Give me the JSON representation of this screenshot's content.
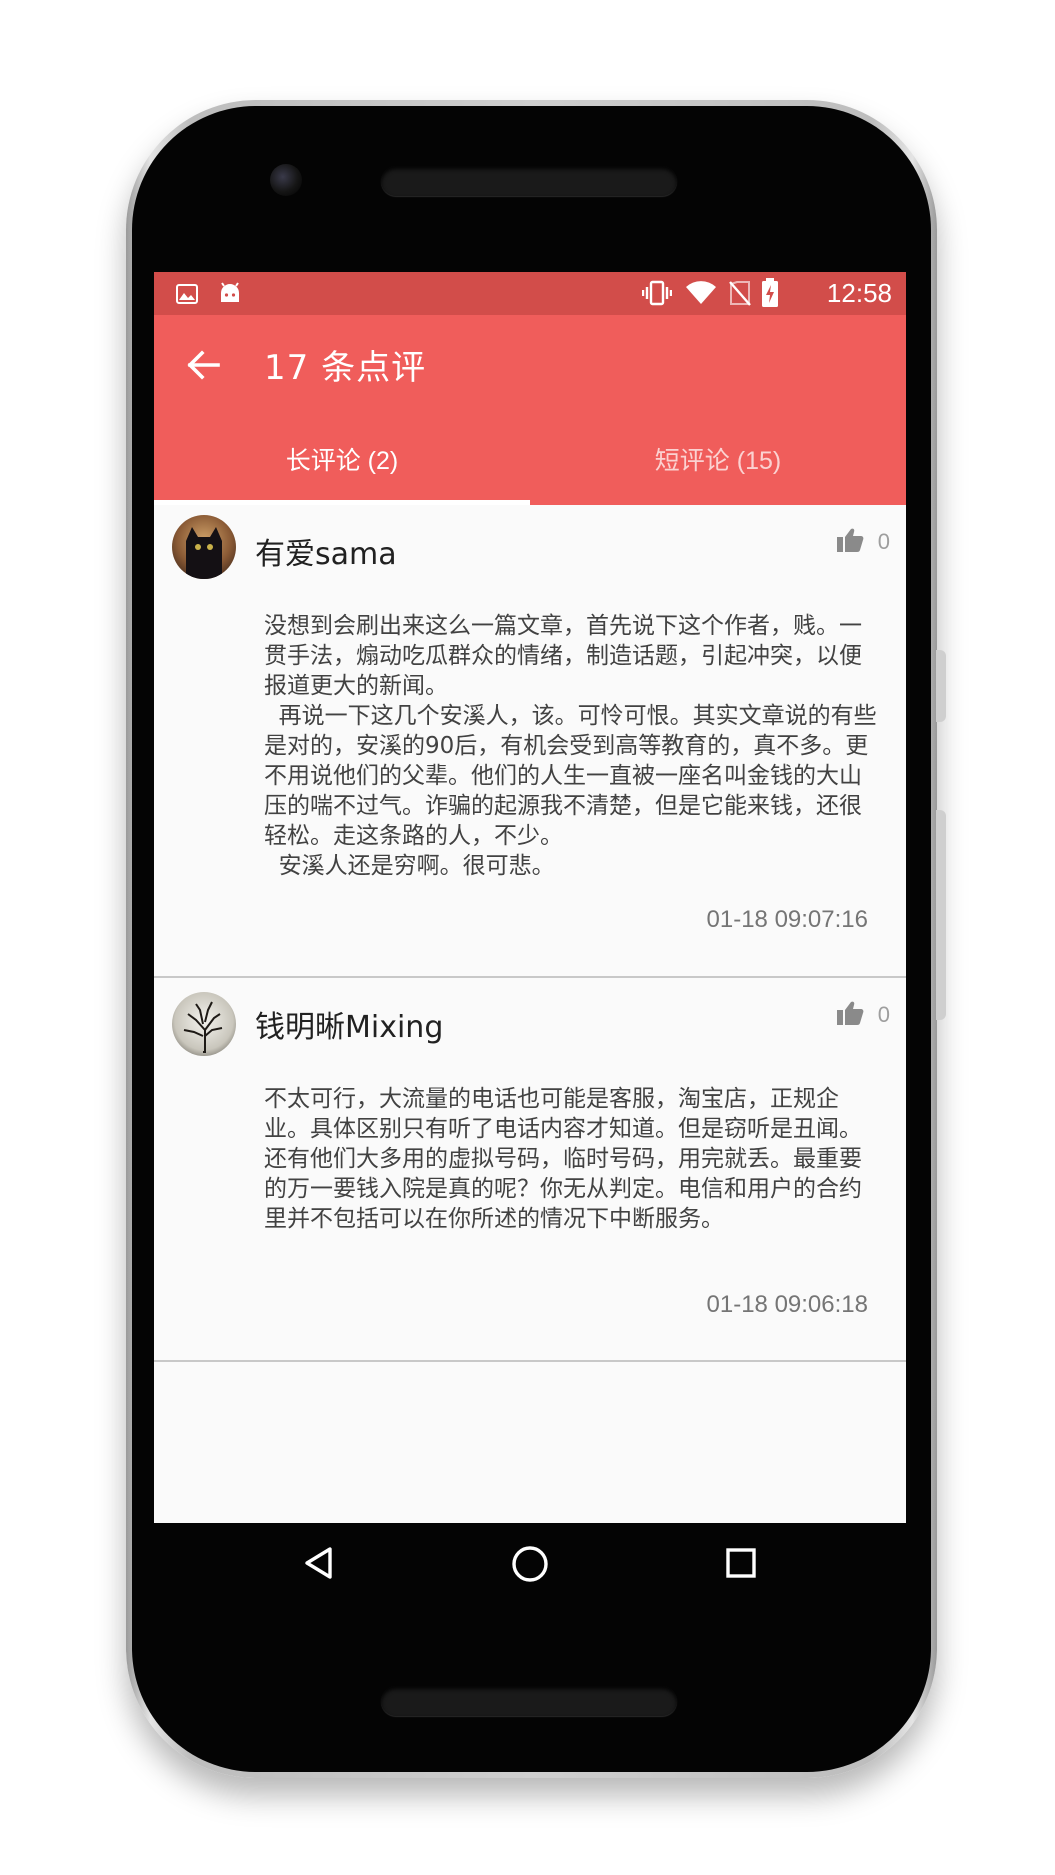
{
  "status_bar": {
    "time": "12:58",
    "color": "#d24d4a",
    "left_icons": [
      "image-icon",
      "android-icon"
    ],
    "right_icons": [
      "vibrate-icon",
      "wifi-icon",
      "no-sim-icon",
      "battery-charging-icon"
    ]
  },
  "app_bar": {
    "title": "17 条点评",
    "color": "#f05d5b"
  },
  "tabs": [
    {
      "label": "长评论 (2)",
      "active": true
    },
    {
      "label": "短评论 (15)",
      "active": false
    }
  ],
  "reviews": [
    {
      "author": "有爱sama",
      "likes": "0",
      "content": "没想到会刷出来这么一篇文章，首先说下这个作者，贱。一贯手法，煽动吃瓜群众的情绪，制造话题，引起冲突，以便报道更大的新闻。\n  再说一下这几个安溪人，该。可怜可恨。其实文章说的有些是对的，安溪的90后，有机会受到高等教育的，真不多。更不用说他们的父辈。他们的人生一直被一座名叫金钱的大山压的喘不过气。诈骗的起源我不清楚，但是它能来钱，还很轻松。走这条路的人，不少。\n  安溪人还是穷啊。很可悲。",
      "time": "01-18 09:07:16"
    },
    {
      "author": "钱明晰Mixing",
      "likes": "0",
      "content": "不太可行，大流量的电话也可能是客服，淘宝店，正规企业。具体区别只有听了电话内容才知道。但是窃听是丑闻。还有他们大多用的虚拟号码，临时号码，用完就丢。最重要的万一要钱入院是真的呢？你无从判定。电信和用户的合约里并不包括可以在你所述的情况下中断服务。",
      "time": "01-18 09:06:18"
    }
  ],
  "nav_bar": {
    "buttons": [
      "back-triangle-icon",
      "home-circle-icon",
      "recents-square-icon"
    ]
  }
}
